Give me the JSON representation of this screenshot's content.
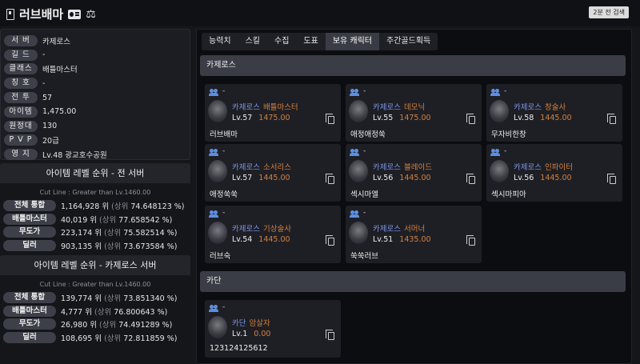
{
  "header": {
    "name": "러브배마",
    "search_label": "2분 전 검색"
  },
  "profile": [
    {
      "label": "서 버",
      "value": "카제로스"
    },
    {
      "label": "길 드",
      "value": "-"
    },
    {
      "label": "클래스",
      "value": "배틀마스터"
    },
    {
      "label": "칭 호",
      "value": "-"
    },
    {
      "label": "전 투",
      "value": "57"
    },
    {
      "label": "아이템",
      "value": "1,475.00"
    },
    {
      "label": "원정대",
      "value": "130"
    },
    {
      "label": "P V P",
      "value": "20급"
    },
    {
      "label": "영 지",
      "value": "Lv.48 광교호수공원"
    }
  ],
  "rank_all": {
    "title": "아이템 레벨 순위 - 전 서버",
    "cutline": "Cut Line : Greater than Lv.1460.00",
    "rows": [
      {
        "label": "전체 통합",
        "rank": "1,164,928 위",
        "pre": "(상위",
        "pct": "74.648123 %)"
      },
      {
        "label": "배틀마스터",
        "rank": "40,019 위",
        "pre": "(상위",
        "pct": "77.658542 %)"
      },
      {
        "label": "무도가",
        "rank": "223,174 위",
        "pre": "(상위",
        "pct": "75.582514 %)"
      },
      {
        "label": "딜러",
        "rank": "903,135 위",
        "pre": "(상위",
        "pct": "73.673584 %)"
      }
    ]
  },
  "rank_server": {
    "title": "아이템 레벨 순위 - 카제로스 서버",
    "cutline": "Cut Line : Greater than Lv.1460.00",
    "rows": [
      {
        "label": "전체 통합",
        "rank": "139,774 위",
        "pre": "(상위",
        "pct": "73.851340 %)"
      },
      {
        "label": "배틀마스터",
        "rank": "4,777 위",
        "pre": "(상위",
        "pct": "76.800643 %)"
      },
      {
        "label": "무도가",
        "rank": "26,980 위",
        "pre": "(상위",
        "pct": "74.491289 %)"
      },
      {
        "label": "딜러",
        "rank": "108,695 위",
        "pre": "(상위",
        "pct": "72.811859 %)"
      }
    ]
  },
  "tabs": [
    "능력치",
    "스킬",
    "수집",
    "도표",
    "보유 캐릭터",
    "주간골드획득"
  ],
  "active_tab": "보유 캐릭터",
  "groups": [
    {
      "server": "카제로스",
      "chars": [
        {
          "guild": "-",
          "server": "카제로스",
          "class": "배틀마스터",
          "level": "Lv.57",
          "ilvl": "1475.00",
          "name": "러브배마"
        },
        {
          "guild": "-",
          "server": "카제로스",
          "class": "데모닉",
          "level": "Lv.55",
          "ilvl": "1475.00",
          "name": "애정애정쑥"
        },
        {
          "guild": "-",
          "server": "카제로스",
          "class": "창술사",
          "level": "Lv.58",
          "ilvl": "1445.00",
          "name": "무자비한창"
        },
        {
          "guild": "-",
          "server": "카제로스",
          "class": "소서리스",
          "level": "Lv.57",
          "ilvl": "1445.00",
          "name": "애정쑥쑥"
        },
        {
          "guild": "-",
          "server": "카제로스",
          "class": "블레이드",
          "level": "Lv.56",
          "ilvl": "1445.00",
          "name": "섹시마엘"
        },
        {
          "guild": "-",
          "server": "카제로스",
          "class": "인파이터",
          "level": "Lv.56",
          "ilvl": "1445.00",
          "name": "섹시마피아"
        },
        {
          "guild": "-",
          "server": "카제로스",
          "class": "기상술사",
          "level": "Lv.54",
          "ilvl": "1445.00",
          "name": "러브숙"
        },
        {
          "guild": "-",
          "server": "카제로스",
          "class": "서머너",
          "level": "Lv.51",
          "ilvl": "1435.00",
          "name": "쑥쑥러브"
        }
      ]
    },
    {
      "server": "카단",
      "chars": [
        {
          "guild": "-",
          "server": "카단",
          "class": "암살자",
          "level": "Lv.1",
          "ilvl": "0.00",
          "name": "123124125612"
        }
      ]
    }
  ]
}
